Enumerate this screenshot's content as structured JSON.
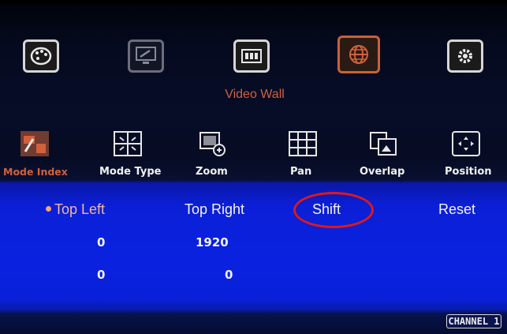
{
  "top_menu": {
    "icons": [
      "palette-icon",
      "monitor-settings-icon",
      "video-wall-icon",
      "globe-icon",
      "gear-icon"
    ],
    "active_index": 3,
    "section_title": "Video Wall"
  },
  "functions": {
    "items": [
      {
        "label": "Mode Index",
        "icon": "mode-index-icon",
        "active": true
      },
      {
        "label": "Mode Type",
        "icon": "mode-type-icon",
        "active": false
      },
      {
        "label": "Zoom",
        "icon": "zoom-icon",
        "active": false
      },
      {
        "label": "Pan",
        "icon": "pan-grid-icon",
        "active": false
      },
      {
        "label": "Overlap",
        "icon": "overlap-icon",
        "active": false
      },
      {
        "label": "Position",
        "icon": "position-arrows-icon",
        "active": false
      }
    ]
  },
  "panel": {
    "options": [
      "Top Left",
      "Top Right",
      "Shift",
      "Reset"
    ],
    "selected": "Top Left",
    "highlighted": "Shift",
    "values": {
      "top_left_x": "0",
      "top_right_x": "1920",
      "top_left_y": "0",
      "top_right_y": "0"
    }
  },
  "status": {
    "channel": "CHANNEL 1"
  },
  "colors": {
    "accent": "#d2603a",
    "panel_blue": "#0a22e0",
    "highlight_ring": "#e01818"
  }
}
